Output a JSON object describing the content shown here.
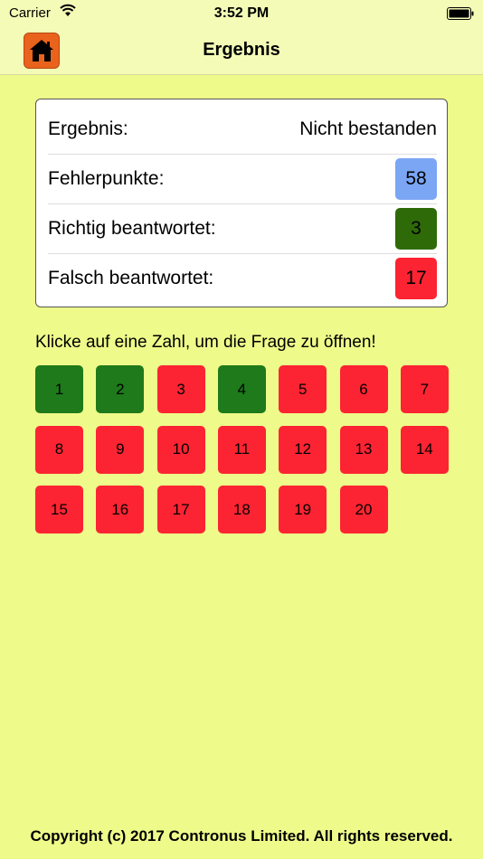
{
  "status_bar": {
    "carrier": "Carrier",
    "time": "3:52 PM"
  },
  "nav": {
    "title": "Ergebnis",
    "home_icon": "home-icon"
  },
  "result": {
    "ergebnis_label": "Ergebnis:",
    "ergebnis_value": "Nicht bestanden",
    "fehler_label": "Fehlerpunkte:",
    "fehler_value": "58",
    "richtig_label": "Richtig beantwortet:",
    "richtig_value": "3",
    "falsch_label": "Falsch beantwortet:",
    "falsch_value": "17"
  },
  "hint": "Klicke auf eine Zahl, um die Frage zu öffnen!",
  "questions": [
    {
      "label": "1",
      "status": "correct"
    },
    {
      "label": "2",
      "status": "correct"
    },
    {
      "label": "3",
      "status": "wrong"
    },
    {
      "label": "4",
      "status": "correct"
    },
    {
      "label": "5",
      "status": "wrong"
    },
    {
      "label": "6",
      "status": "wrong"
    },
    {
      "label": "7",
      "status": "wrong"
    },
    {
      "label": "8",
      "status": "wrong"
    },
    {
      "label": "9",
      "status": "wrong"
    },
    {
      "label": "10",
      "status": "wrong"
    },
    {
      "label": "11",
      "status": "wrong"
    },
    {
      "label": "12",
      "status": "wrong"
    },
    {
      "label": "13",
      "status": "wrong"
    },
    {
      "label": "14",
      "status": "wrong"
    },
    {
      "label": "15",
      "status": "wrong"
    },
    {
      "label": "16",
      "status": "wrong"
    },
    {
      "label": "17",
      "status": "wrong"
    },
    {
      "label": "18",
      "status": "wrong"
    },
    {
      "label": "19",
      "status": "wrong"
    },
    {
      "label": "20",
      "status": "wrong"
    }
  ],
  "colors": {
    "correct": "#1e7a1a",
    "wrong": "#fc2432",
    "fehler_badge": "#7aa6f4",
    "richtig_badge": "#2f6a08",
    "falsch_badge": "#fc2432",
    "background": "#eefb8a",
    "home_button": "#e9631d"
  },
  "footer": "Copyright (c) 2017 Contronus Limited. All rights reserved."
}
